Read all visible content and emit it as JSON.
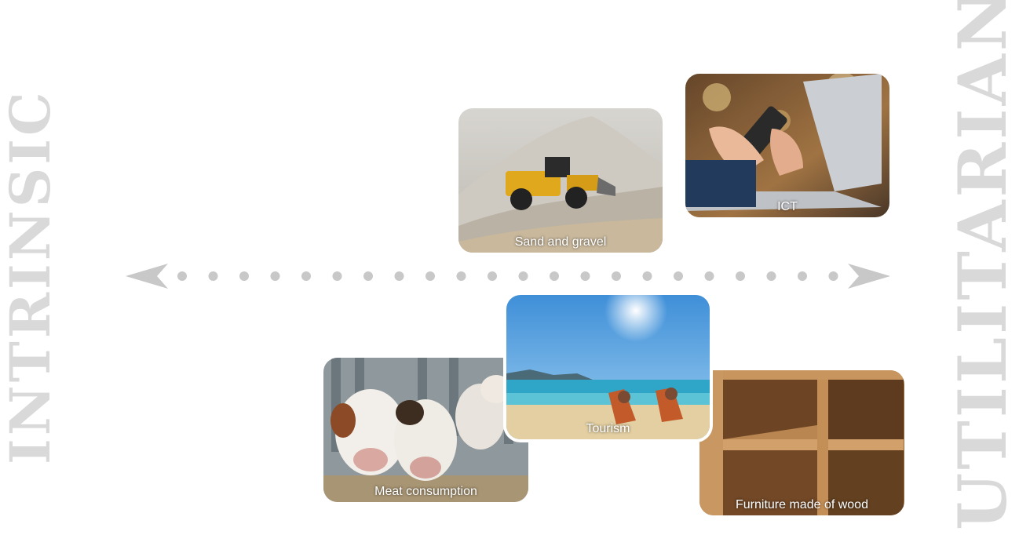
{
  "labels": {
    "left": "INTRINSIC",
    "right": "UTILITARIAN"
  },
  "axis": {
    "color": "#c8c8c8",
    "style": "dotted double-headed arrow"
  },
  "cards": {
    "sand": "Sand and gravel",
    "ict": "ICT",
    "meat": "Meat consumption",
    "tourism": "Tourism",
    "furniture": "Furniture made of wood"
  }
}
